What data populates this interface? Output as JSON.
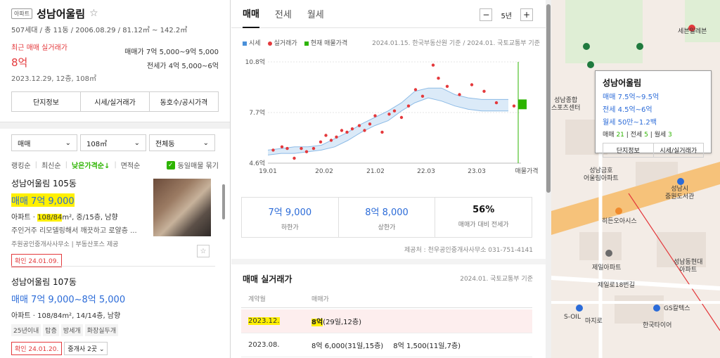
{
  "complex": {
    "type_badge": "아파트",
    "name": "성남어울림",
    "meta": "507세대 / 총 11동 / 2006.08.29 / 81.12㎡ ~ 142.2㎡",
    "recent_label": "최근 매매 실거래가",
    "recent_price": "8억",
    "recent_date": "2023.12.29, 12층, 108㎡",
    "sale_range_label": "매매가",
    "sale_range": "7억 5,000~9억 5,000",
    "jeonse_range_label": "전세가",
    "jeonse_range": "4억 5,000~6억"
  },
  "info_tabs": [
    "단지정보",
    "시세/실거래가",
    "동호수/공시가격"
  ],
  "filters": {
    "trade": "매매",
    "area": "108㎡",
    "dong": "전체동"
  },
  "sort": {
    "options": [
      "랭킹순",
      "최신순",
      "낮은가격순↓",
      "면적순"
    ],
    "group_same": "동일매물 묶기"
  },
  "listings": [
    {
      "name": "성남어울림 105동",
      "price": "매매 7억 9,000",
      "desc_prefix": "아파트 · ",
      "desc_area": "108/84",
      "desc_suffix": "m², 중/15층, 남향",
      "desc2": "주인거주 리모델링해서 깨끗하고 로얄층 ...",
      "agent": "주원공인중개사사무소 | 부동산포스 제공",
      "confirm": "확인 24.01.09."
    },
    {
      "name": "성남어울림 107동",
      "price": "매매 7억 9,000~8억 5,000",
      "desc": "아파트 · 108/84m², 14/14층, 남향",
      "tags": [
        "25년이내",
        "탑층",
        "방세개",
        "화장실두개"
      ],
      "confirm": "확인 24.01.20.",
      "agent_btn": "중개사 2곳 ⌄"
    }
  ],
  "price_tabs": [
    "매매",
    "전세",
    "월세"
  ],
  "period": {
    "minus": "−",
    "value": "5년",
    "plus": "+"
  },
  "legend": {
    "market": "시세",
    "actual": "실거래가",
    "current": "현재 매물가격",
    "basis": "2024.01.15. 한국부동산원 기준 / 2024.01. 국토교통부 기준"
  },
  "chart_data": {
    "type": "line",
    "x_ticks": [
      "19.01",
      "20.02",
      "21.02",
      "22.03",
      "23.03",
      "매물가격"
    ],
    "y_ticks": [
      "10.8억",
      "7.7억",
      "4.6억"
    ],
    "ylim": [
      4.6,
      10.8
    ],
    "series": [
      {
        "name": "시세",
        "band_low": [
          5.1,
          5.2,
          5.2,
          5.3,
          5.4,
          5.6,
          6.0,
          6.5,
          6.9,
          7.2,
          7.8,
          8.3,
          8.6,
          8.4,
          8.1,
          7.9,
          7.8,
          7.8,
          7.8
        ],
        "band_high": [
          5.4,
          5.5,
          5.6,
          5.6,
          5.7,
          6.1,
          6.5,
          7.0,
          7.4,
          7.8,
          8.3,
          9.0,
          9.2,
          9.2,
          8.8,
          8.6,
          8.5,
          8.5,
          8.5
        ]
      },
      {
        "name": "실거래가",
        "points": [
          [
            0.3,
            5.4
          ],
          [
            0.8,
            5.6
          ],
          [
            1.1,
            5.5
          ],
          [
            1.5,
            4.9
          ],
          [
            1.9,
            5.5
          ],
          [
            2.2,
            5.3
          ],
          [
            2.6,
            5.5
          ],
          [
            3.0,
            5.9
          ],
          [
            3.3,
            6.3
          ],
          [
            3.6,
            6.0
          ],
          [
            3.9,
            6.2
          ],
          [
            4.2,
            6.6
          ],
          [
            4.5,
            6.5
          ],
          [
            4.8,
            6.7
          ],
          [
            5.2,
            6.9
          ],
          [
            5.5,
            6.6
          ],
          [
            5.8,
            7.0
          ],
          [
            6.1,
            7.5
          ],
          [
            6.5,
            6.5
          ],
          [
            6.9,
            7.6
          ],
          [
            7.2,
            7.8
          ],
          [
            7.6,
            7.4
          ],
          [
            8.0,
            8.1
          ],
          [
            8.4,
            9.1
          ],
          [
            8.8,
            8.7
          ],
          [
            9.4,
            10.6
          ],
          [
            9.7,
            9.8
          ],
          [
            10.2,
            9.3
          ],
          [
            10.9,
            8.8
          ],
          [
            11.6,
            9.4
          ],
          [
            12.3,
            9.0
          ],
          [
            13.0,
            8.3
          ],
          [
            14.0,
            8.1
          ]
        ]
      },
      {
        "name": "현재 매물가격",
        "low": 7.9,
        "high": 8.5
      }
    ]
  },
  "stats": [
    {
      "value": "7억 9,000",
      "label": "하한가"
    },
    {
      "value": "8억 8,000",
      "label": "상한가"
    },
    {
      "value": "56%",
      "label": "매매가 대비 전세가"
    }
  ],
  "provider": "제공처 : 천우공인중개사사무소 031-751-4141",
  "real_trade": {
    "title": "매매 실거래가",
    "basis": "2024.01. 국토교통부 기준",
    "col1": "계약월",
    "col2": "매매가",
    "rows": [
      {
        "month": "2023.12.",
        "price": "8억",
        "price_extra": "(29일,12층)",
        "price2": ""
      },
      {
        "month": "2023.08.",
        "price": "8억 6,000",
        "price_extra": "(31일,15층)",
        "price2": "8억 1,500(11일,7층)"
      }
    ]
  },
  "map": {
    "labels": [
      "세븐일레븐",
      "성남종합\n스포츠센터",
      "성남금호\n어울림아파트",
      "성남시\n중원도서관",
      "히든오아시스",
      "제일아파트",
      "제일로18번길",
      "S-OIL",
      "마지로",
      "GS칼텍스",
      "한국타이어",
      "성남동현대\n아파트"
    ],
    "colors": {
      "road": "#f6c27a",
      "park": "#dfeed5",
      "block": "#e8dfd7"
    }
  },
  "map_popup": {
    "name": "성남어울림",
    "sale": "매매 7.5억~9.5억",
    "jeonse": "전세 4.5억~6억",
    "monthly": "월세 50만~1.2백",
    "count_sale_label": "매매",
    "count_sale": "21",
    "count_jeonse_label": "전세",
    "count_jeonse": "5",
    "count_monthly_label": "월세",
    "count_monthly": "3",
    "btn1": "단지정보",
    "btn2": "시세/실거래가"
  }
}
